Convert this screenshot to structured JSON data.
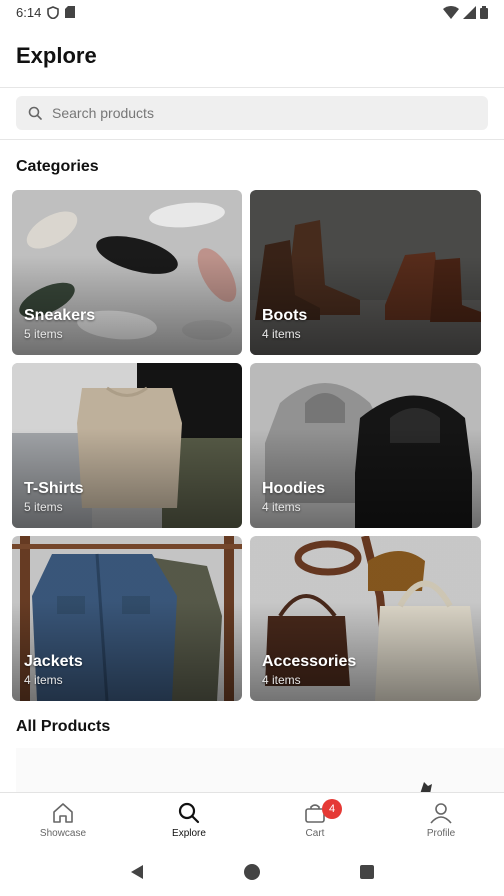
{
  "status_bar": {
    "time": "6:14"
  },
  "header": {
    "title": "Explore"
  },
  "search": {
    "placeholder": "Search products"
  },
  "sections": {
    "categories": "Categories",
    "all_products": "All Products"
  },
  "categories": [
    {
      "name": "Sneakers",
      "count": "5 items",
      "image": "sneakers-photo"
    },
    {
      "name": "Boots",
      "count": "4 items",
      "image": "boots-photo"
    },
    {
      "name": "T-Shirts",
      "count": "5 items",
      "image": "tshirts-photo"
    },
    {
      "name": "Hoodies",
      "count": "4 items",
      "image": "hoodies-photo"
    },
    {
      "name": "Jackets",
      "count": "4 items",
      "image": "jackets-photo"
    },
    {
      "name": "Accessories",
      "count": "4 items",
      "image": "accessories-photo"
    }
  ],
  "bottom_nav": {
    "items": [
      {
        "label": "Showcase",
        "icon": "home-icon"
      },
      {
        "label": "Explore",
        "icon": "search-icon",
        "active": true
      },
      {
        "label": "Cart",
        "icon": "cart-icon",
        "badge": "4"
      },
      {
        "label": "Profile",
        "icon": "person-icon"
      }
    ]
  },
  "colors": {
    "badge": "#e53935",
    "search_bg": "#efefef"
  }
}
